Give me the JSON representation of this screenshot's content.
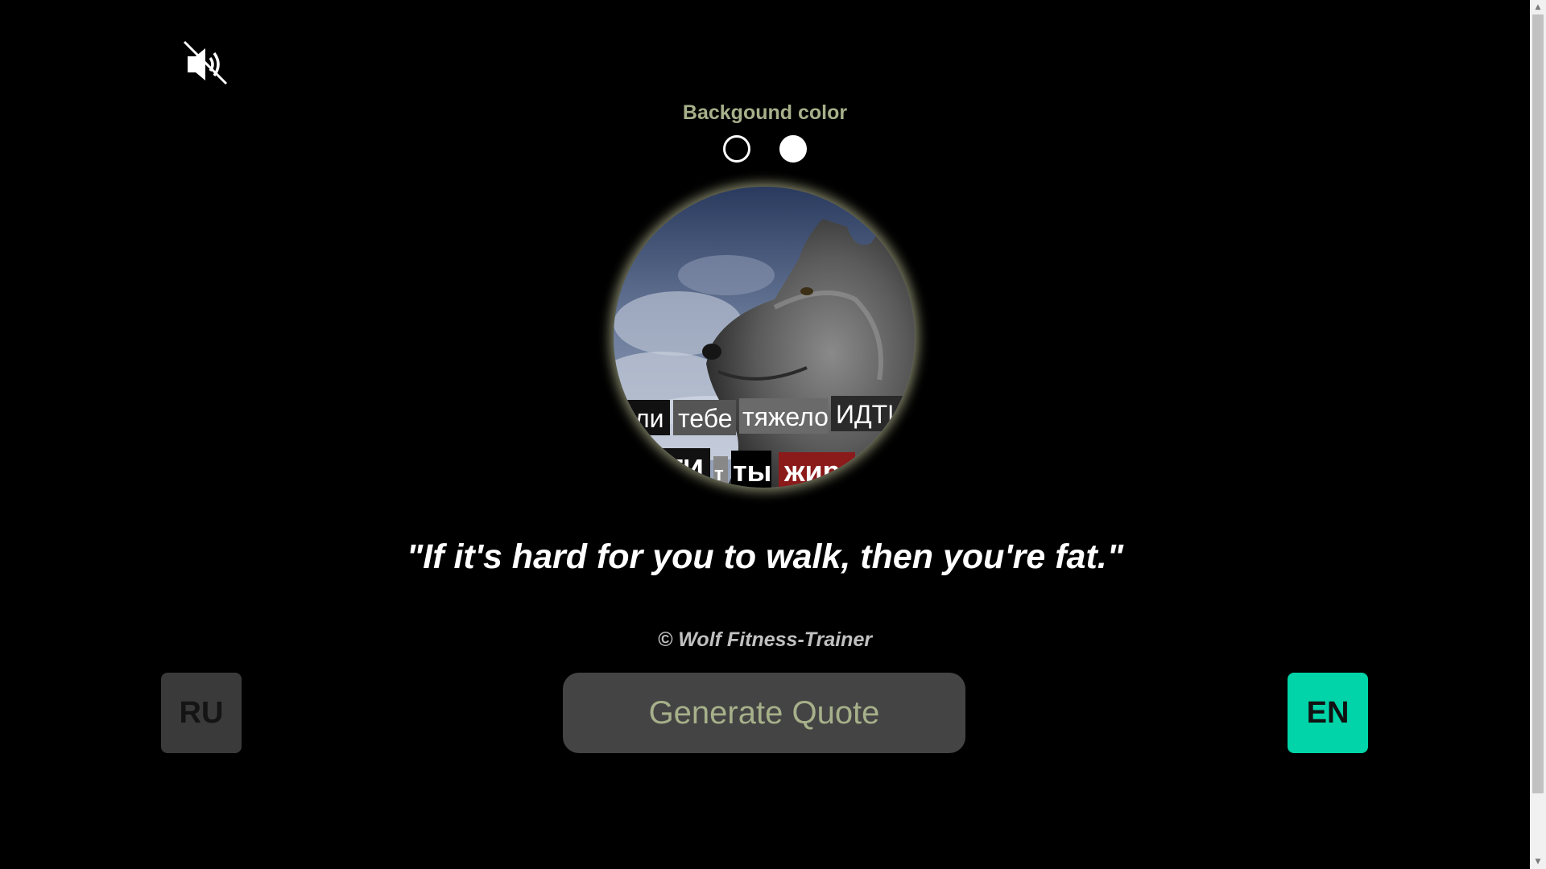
{
  "sound": {
    "icon": "speaker-muted-icon"
  },
  "background_picker": {
    "label": "Backgound color",
    "options": [
      {
        "name": "black",
        "color": "#000000"
      },
      {
        "name": "white",
        "color": "#ffffff"
      }
    ]
  },
  "avatar": {
    "caption_line1": [
      "сли",
      "тебе",
      "тяжело",
      "ИДТИ"
    ],
    "caption_line2": [
      "ТИ",
      "т",
      "ты",
      "жир"
    ]
  },
  "quote": {
    "text": "\"If it's hard for you to walk, then you're fat.\"",
    "author": "© Wolf Fitness-Trainer"
  },
  "buttons": {
    "ru_label": "RU",
    "generate_label": "Generate Quote",
    "en_label": "EN"
  },
  "colors": {
    "accent_en": "#00d4a8",
    "label_text": "#a6b08a",
    "button_gray": "#444444"
  }
}
